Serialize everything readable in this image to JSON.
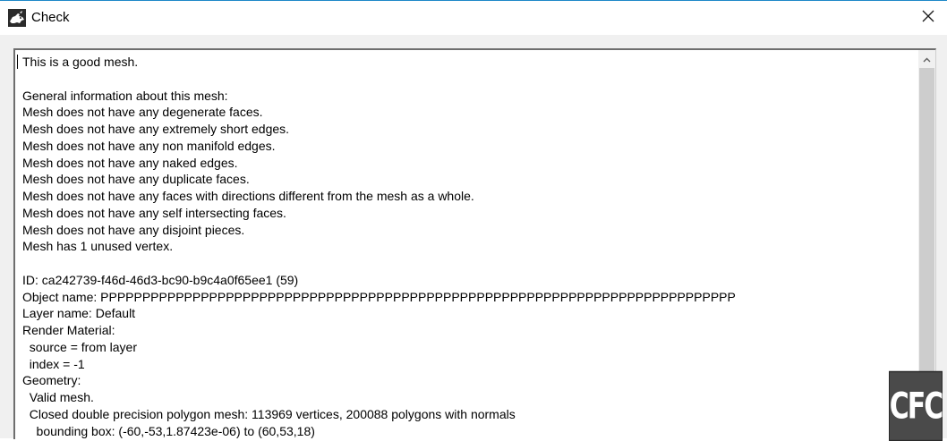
{
  "window": {
    "title": "Check",
    "app_icon": "rhino-icon",
    "close_icon": "close-icon",
    "accent_color": "#1e88c8"
  },
  "report": {
    "lines": [
      "This is a good mesh.",
      "",
      "General information about this mesh:",
      "Mesh does not have any degenerate faces.",
      "Mesh does not have any extremely short edges.",
      "Mesh does not have any non manifold edges.",
      "Mesh does not have any naked edges.",
      "Mesh does not have any duplicate faces.",
      "Mesh does not have any faces with directions different from the mesh as a whole.",
      "Mesh does not have any self intersecting faces.",
      "Mesh does not have any disjoint pieces.",
      "Mesh has 1 unused vertex.",
      "",
      "ID: ca242739-f46d-46d3-bc90-b9c4a0f65ee1 (59)",
      "Object name: PPPPPPPPPPPPPPPPPPPPPPPPPPPPPPPPPPPPPPPPPPPPPPPPPPPPPPPPPPPPPPPPPPPPPPPPPPPP",
      "Layer name: Default",
      "Render Material:",
      "  source = from layer",
      "  index = -1",
      "Geometry:",
      "  Valid mesh.",
      "  Closed double precision polygon mesh: 113969 vertices, 200088 polygons with normals",
      "    bounding box: (-60,-53,1.87423e-06) to (60,53,18)"
    ]
  },
  "scrollbar": {
    "up_icon": "chevron-up-icon"
  },
  "watermark": {
    "text": "CFC"
  }
}
